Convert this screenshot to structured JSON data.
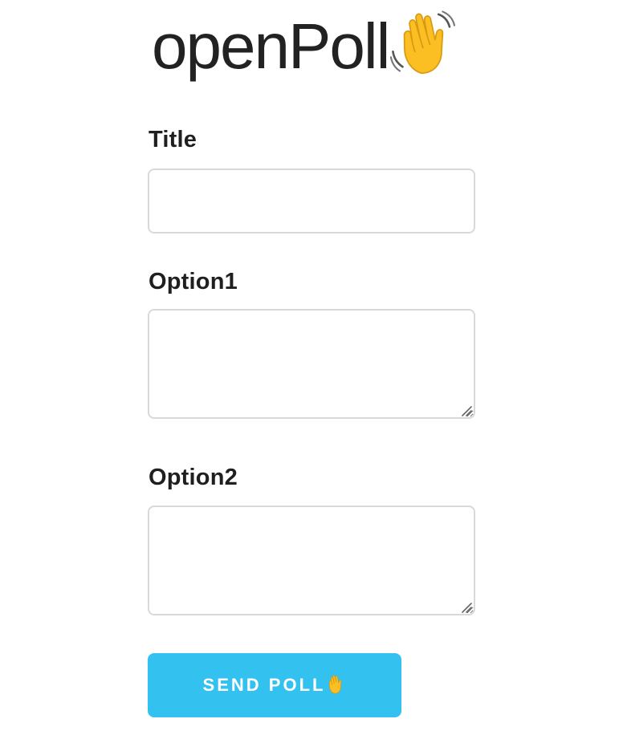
{
  "header": {
    "logo_text": "openPoll",
    "logo_icon": "waving-hand-emoji"
  },
  "form": {
    "title_label": "Title",
    "title_value": "",
    "option1_label": "Option1",
    "option1_value": "",
    "option2_label": "Option2",
    "option2_value": "",
    "send_label": "SEND POLL",
    "send_icon": "waving-hand-emoji"
  },
  "colors": {
    "accent": "#33c1ef",
    "border": "#d9d9d9",
    "text": "#1f1f1f",
    "emoji": "#fbbf24"
  }
}
